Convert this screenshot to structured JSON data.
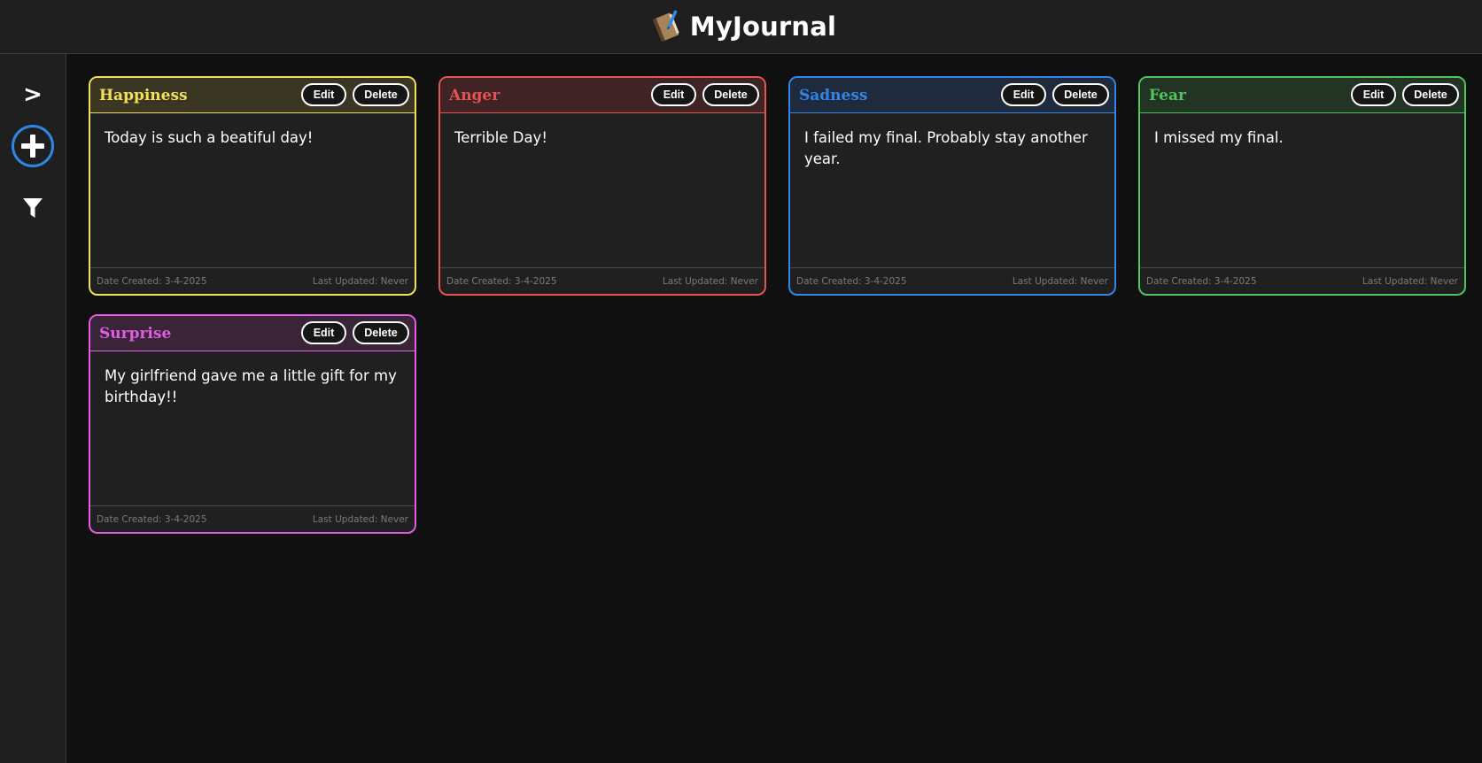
{
  "app": {
    "title": "MyJournal"
  },
  "sidebar": {
    "expand_label": ">",
    "add_icon": "plus-circle-icon",
    "filter_icon": "filter-icon"
  },
  "buttons": {
    "edit": "Edit",
    "delete": "Delete"
  },
  "entries": [
    {
      "emotion": "Happiness",
      "text": "Today is such a beatiful day!",
      "date_created": "Date Created: 3-4-2025",
      "last_updated": "Last Updated: Never",
      "color": "#f1e05a",
      "header_bg": "#3a3623"
    },
    {
      "emotion": "Anger",
      "text": "Terrible Day!",
      "date_created": "Date Created: 3-4-2025",
      "last_updated": "Last Updated: Never",
      "color": "#e55353",
      "header_bg": "#402425"
    },
    {
      "emotion": "Sadness",
      "text": "I failed my final. Probably stay another year.",
      "date_created": "Date Created: 3-4-2025",
      "last_updated": "Last Updated: Never",
      "color": "#2f86e6",
      "header_bg": "#1f2b3d"
    },
    {
      "emotion": "Fear",
      "text": "I missed my final.",
      "date_created": "Date Created: 3-4-2025",
      "last_updated": "Last Updated: Never",
      "color": "#4fc55b",
      "header_bg": "#243424"
    },
    {
      "emotion": "Surprise",
      "text": "My girlfriend gave me a little gift for my birthday!!",
      "date_created": "Date Created: 3-4-2025",
      "last_updated": "Last Updated: Never",
      "color": "#e25ce6",
      "header_bg": "#3a2538"
    }
  ]
}
